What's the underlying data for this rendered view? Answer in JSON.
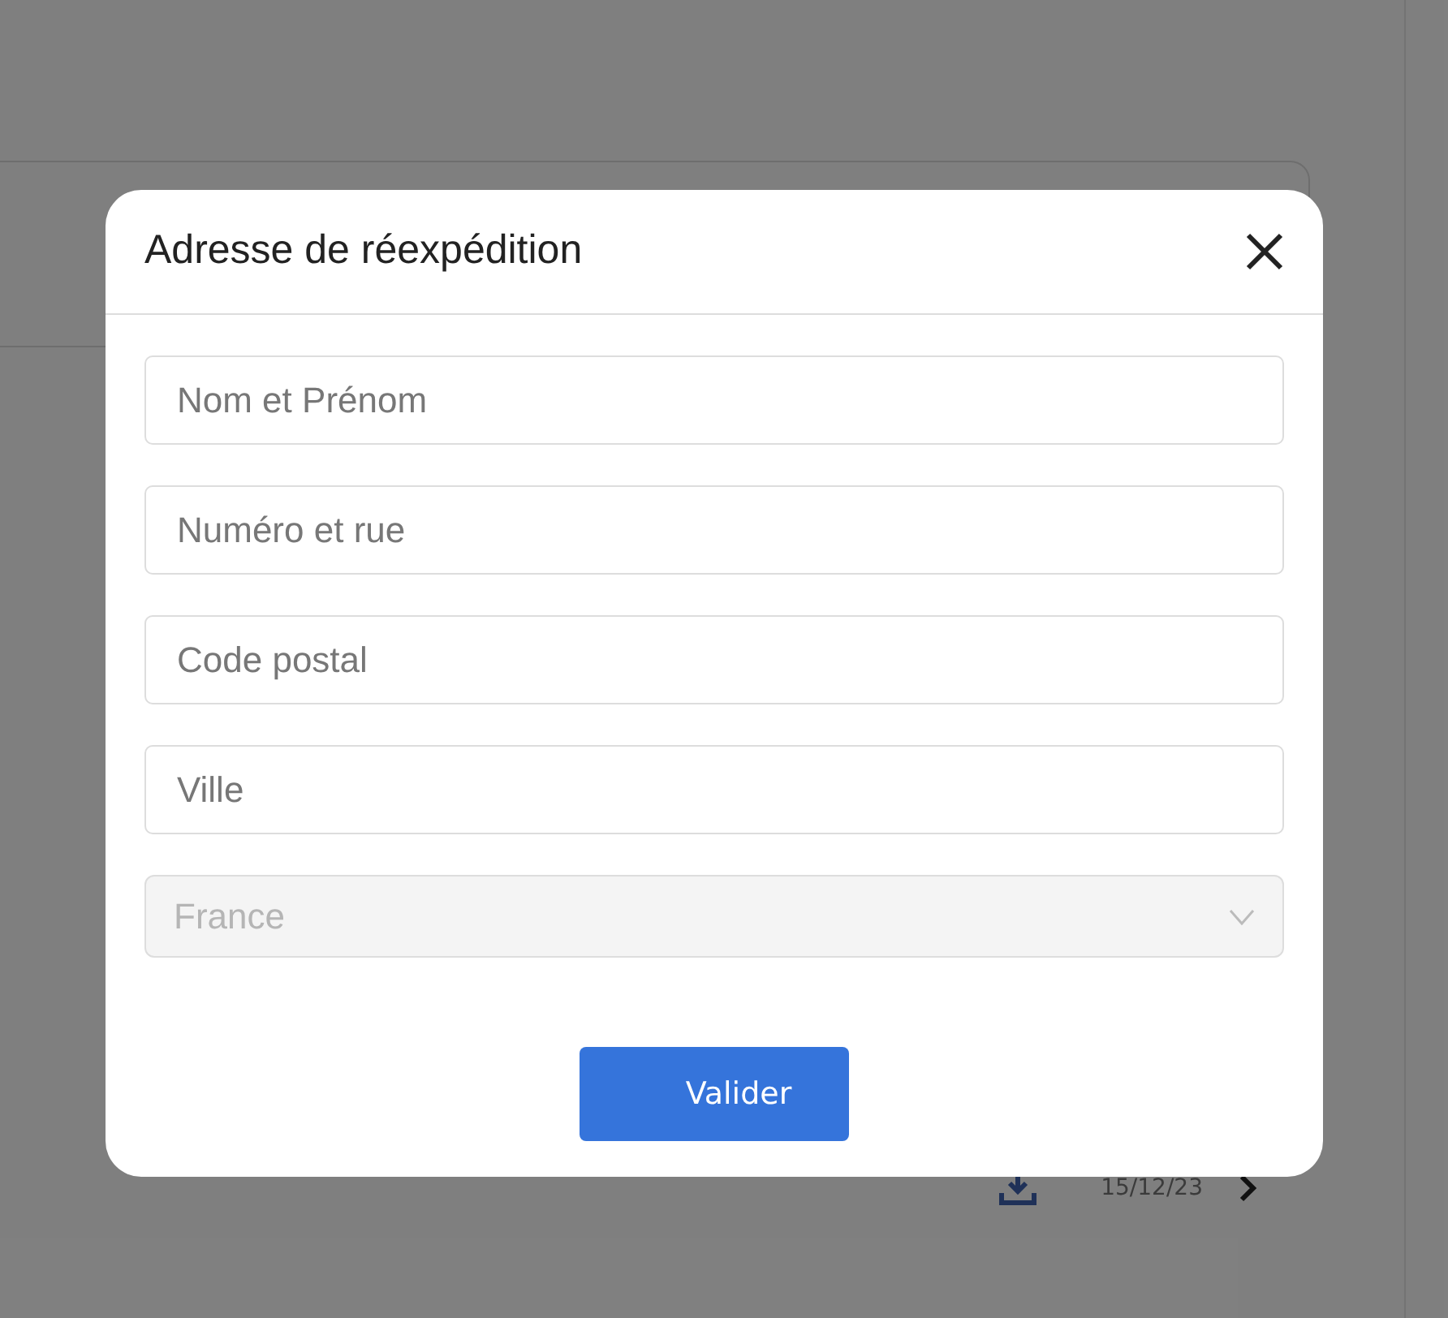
{
  "background": {
    "row": {
      "date": "15/12/23"
    }
  },
  "modal": {
    "title": "Adresse de réexpédition",
    "fields": [
      {
        "placeholder": "Nom et Prénom"
      },
      {
        "placeholder": "Numéro et rue"
      },
      {
        "placeholder": "Code postal"
      },
      {
        "placeholder": "Ville"
      }
    ],
    "country": {
      "value": "France",
      "disabled": true
    },
    "button": "Valider"
  }
}
